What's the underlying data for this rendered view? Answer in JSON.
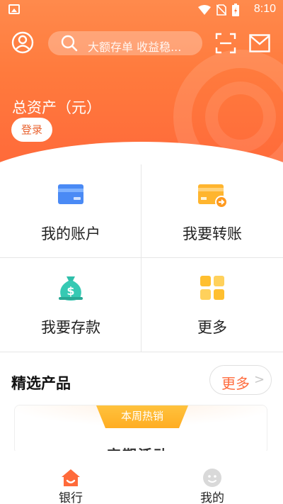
{
  "status_bar": {
    "time": "8:10"
  },
  "header": {
    "search_placeholder": "大额存单 收益稳...",
    "assets_title": "总资产（元）",
    "login_label": "登录"
  },
  "grid": {
    "items": [
      {
        "label": "我的账户",
        "icon": "card-icon"
      },
      {
        "label": "我要转账",
        "icon": "transfer-card-icon"
      },
      {
        "label": "我要存款",
        "icon": "money-bag-icon"
      },
      {
        "label": "更多",
        "icon": "apps-grid-icon"
      }
    ]
  },
  "featured": {
    "title": "精选产品",
    "more_label": "更多",
    "more_arrow": ">",
    "ribbon_label": "本周热销",
    "card_sub": "定期活动"
  },
  "bottom_nav": {
    "items": [
      {
        "label": "银行",
        "icon": "home-icon"
      },
      {
        "label": "我的",
        "icon": "profile-face-icon"
      }
    ]
  },
  "colors": {
    "brand_orange": "#ff7a3d",
    "accent_text": "#ff6b3d",
    "ribbon": "#ffb42a"
  }
}
